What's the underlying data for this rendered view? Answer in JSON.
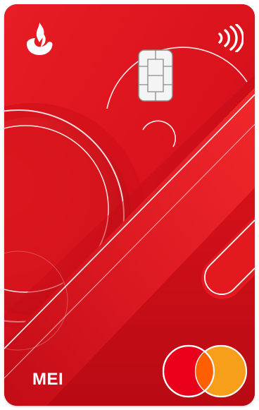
{
  "card": {
    "label": "MEI",
    "issuer_icon": "santander-flame-icon",
    "contactless_icon": "contactless-icon",
    "chip_icon": "emv-chip-icon",
    "network_icon": "mastercard-logo-icon"
  },
  "colors": {
    "card_red": "#d9121c",
    "card_red_dark": "#b40a14",
    "card_red_light": "#ef2a2e",
    "chip": "#f2f2f2",
    "mastercard_red": "#eb001b",
    "mastercard_orange": "#f79e1b",
    "mastercard_overlap": "#ff5f00"
  }
}
